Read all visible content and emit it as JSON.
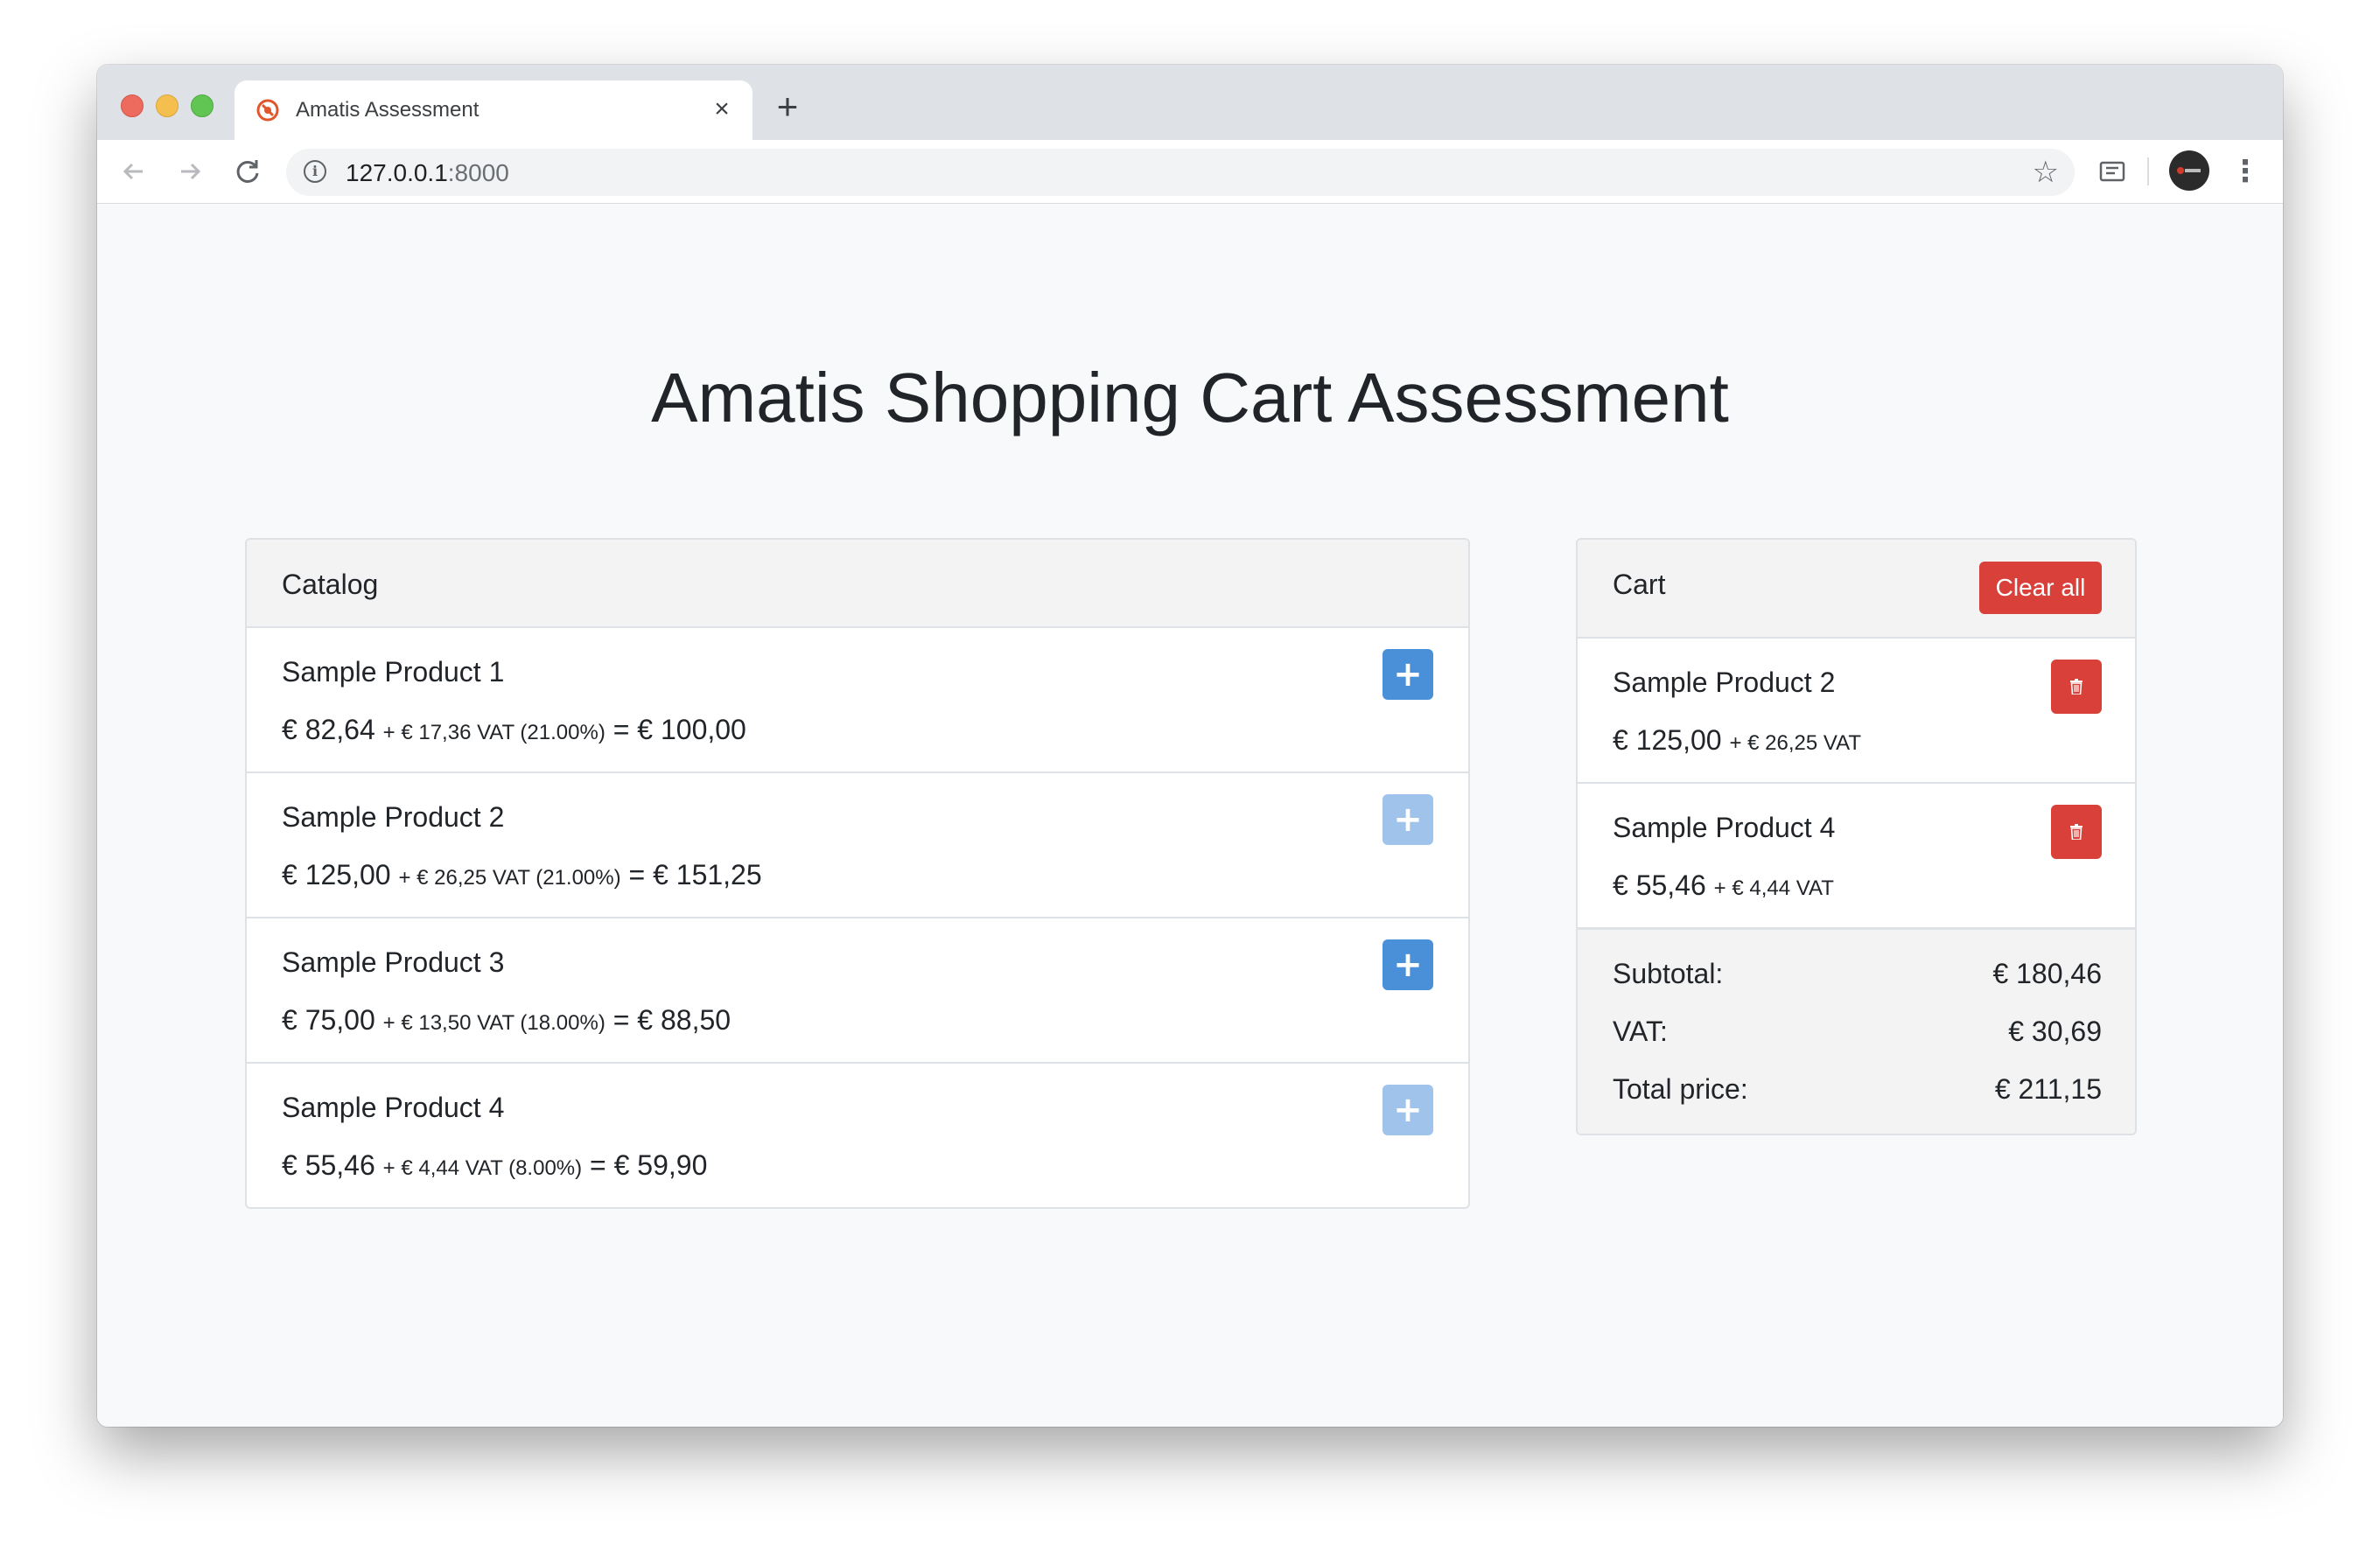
{
  "browser": {
    "tab_title": "Amatis Assessment",
    "close_glyph": "×",
    "new_tab_glyph": "+",
    "url_host": "127.0.0.1",
    "url_port": ":8000",
    "icons": {
      "back": "arrow-left-icon",
      "forward": "arrow-right-icon",
      "reload": "reload-icon",
      "info": "info-icon",
      "bookmark": "star-icon",
      "extension": "cast-icon",
      "menu": "kebab-menu-icon"
    }
  },
  "page": {
    "title": "Amatis Shopping Cart Assessment"
  },
  "catalog": {
    "title": "Catalog",
    "items": [
      {
        "name": "Sample Product 1",
        "net": "€ 82,64",
        "vat": "+ € 17,36 VAT (21.00%)",
        "gross": "= € 100,00",
        "in_cart": false
      },
      {
        "name": "Sample Product 2",
        "net": "€ 125,00",
        "vat": "+ € 26,25 VAT (21.00%)",
        "gross": "= € 151,25",
        "in_cart": true
      },
      {
        "name": "Sample Product 3",
        "net": "€ 75,00",
        "vat": "+ € 13,50 VAT (18.00%)",
        "gross": "= € 88,50",
        "in_cart": false
      },
      {
        "name": "Sample Product 4",
        "net": "€ 55,46",
        "vat": "+ € 4,44 VAT (8.00%)",
        "gross": "= € 59,90",
        "in_cart": true
      }
    ]
  },
  "cart": {
    "title": "Cart",
    "clear_label": "Clear all",
    "items": [
      {
        "name": "Sample Product 2",
        "net": "€ 125,00",
        "vat": "+ € 26,25 VAT"
      },
      {
        "name": "Sample Product 4",
        "net": "€ 55,46",
        "vat": "+ € 4,44 VAT"
      }
    ],
    "totals": {
      "subtotal_label": "Subtotal:",
      "subtotal": "€ 180,46",
      "vat_label": "VAT:",
      "vat": "€ 30,69",
      "total_label": "Total price:",
      "total": "€ 211,15"
    }
  },
  "colors": {
    "add_button": "#4a90d9",
    "add_button_disabled": "#9fc3ea",
    "danger": "#d9403a",
    "page_background": "#f8f9fa"
  }
}
